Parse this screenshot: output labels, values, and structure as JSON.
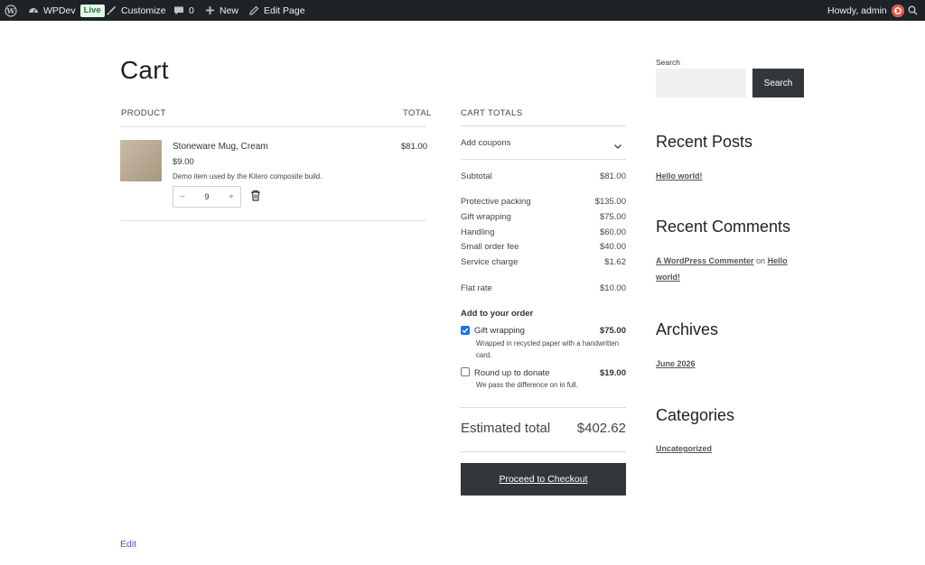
{
  "admin_bar": {
    "site_name": "WPDev",
    "live_badge": "Live",
    "customize": "Customize",
    "comments_count": "0",
    "new": "New",
    "edit_page": "Edit Page",
    "greeting": "Howdy, admin"
  },
  "page": {
    "title": "Cart",
    "edit_link": "Edit"
  },
  "cart": {
    "col_product": "PRODUCT",
    "col_total": "TOTAL",
    "item": {
      "name": "Stoneware Mug, Cream",
      "price": "$9.00",
      "description": "Demo item used by the Kitero composite build.",
      "quantity": "9",
      "minus": "−",
      "plus": "+",
      "total": "$81.00"
    }
  },
  "totals": {
    "heading": "CART TOTALS",
    "coupons": "Add coupons",
    "subtotal_label": "Subtotal",
    "subtotal_value": "$81.00",
    "fees": [
      {
        "label": "Protective packing",
        "value": "$135.00"
      },
      {
        "label": "Gift wrapping",
        "value": "$75.00"
      },
      {
        "label": "Handling",
        "value": "$60.00"
      },
      {
        "label": "Small order fee",
        "value": "$40.00"
      },
      {
        "label": "Service charge",
        "value": "$1.62"
      }
    ],
    "shipping_label": "Flat rate",
    "shipping_value": "$10.00",
    "addons_heading": "Add to your order",
    "addons": [
      {
        "label": "Gift wrapping",
        "price": "$75.00",
        "description": "Wrapped in recycled paper with a handwritten card.",
        "checked": true
      },
      {
        "label": "Round up to donate",
        "price": "$19.00",
        "description": "We pass the difference on in full.",
        "checked": false
      }
    ],
    "estimated_label": "Estimated total",
    "estimated_value": "$402.62",
    "checkout_label": "Proceed to Checkout"
  },
  "sidebar": {
    "search_label": "Search",
    "search_placeholder": "",
    "search_button": "Search",
    "recent_posts_title": "Recent Posts",
    "recent_post": "Hello world!",
    "recent_comments_title": "Recent Comments",
    "comment_author": "A WordPress Commenter",
    "comment_on": "on",
    "comment_post": "Hello world!",
    "archives_title": "Archives",
    "archive_item": "June 2026",
    "categories_title": "Categories",
    "category_item": "Uncategorized"
  },
  "colors": {
    "admin_bar_bg": "#1d2327",
    "button_dark": "#32373c",
    "live_badge_text": "#1a7f37",
    "checkbox_blue": "#1a73e8",
    "edit_link": "#7a3fbf"
  }
}
